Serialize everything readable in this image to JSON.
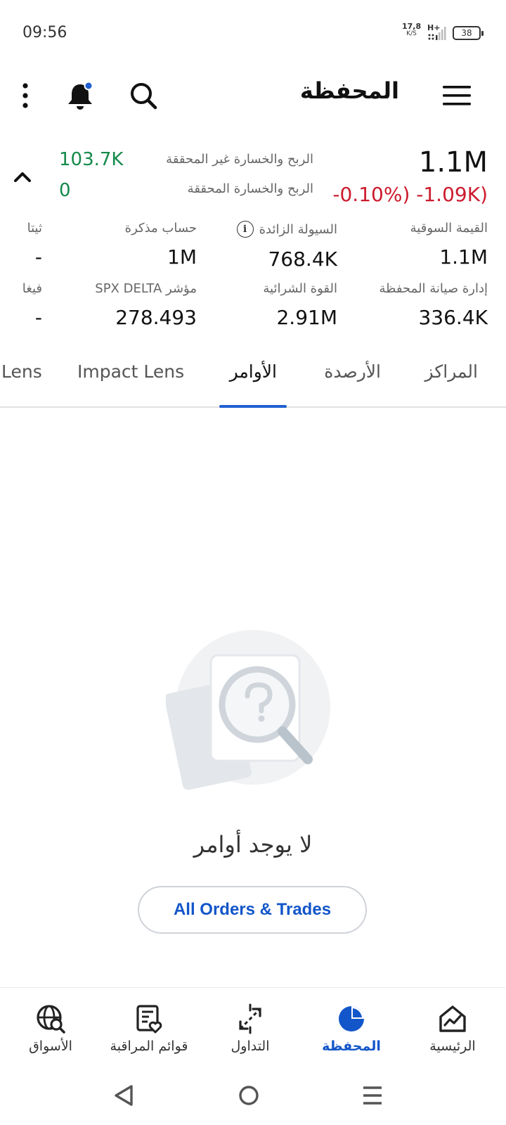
{
  "status": {
    "time": "09:56",
    "net_speed": "17,8",
    "net_unit": "K/S",
    "network_type": "H+",
    "battery": "38"
  },
  "header": {
    "title": "المحفظة",
    "icons": [
      "menu-icon",
      "search-icon",
      "bell-icon",
      "more-vertical-icon"
    ]
  },
  "summary": {
    "market_value": "1.1M",
    "change": "-0.10%) -1.09K)",
    "unrealized_pnl_label": "الربح والخسارة غير المحققة",
    "unrealized_pnl_value": "103.7K",
    "realized_pnl_label": "الربح والخسارة المحققة",
    "realized_pnl_value": "0"
  },
  "metrics": {
    "row1": [
      {
        "label": "القيمة السوقية",
        "value": "1.1M"
      },
      {
        "label": "السيولة الزائدة",
        "value": "768.4K",
        "has_info": true
      },
      {
        "label": "حساب مذكرة",
        "value": "1M"
      },
      {
        "label": "ثيتا",
        "value": "-"
      }
    ],
    "row2": [
      {
        "label": "إدارة صيانة المحفظة",
        "value": "336.4K"
      },
      {
        "label": "القوة الشرائية",
        "value": "2.91M"
      },
      {
        "label": "مؤشر SPX DELTA",
        "value": "278.493"
      },
      {
        "label": "فيغا",
        "value": "-"
      }
    ]
  },
  "tabs": [
    {
      "label": "المراكز",
      "active": false
    },
    {
      "label": "الأرصدة",
      "active": false
    },
    {
      "label": "الأوامر",
      "active": true
    },
    {
      "label": "Impact Lens",
      "active": false
    },
    {
      "label": "Lens",
      "active": false
    }
  ],
  "empty_state": {
    "message": "لا يوجد أوامر",
    "button_label": "All Orders & Trades"
  },
  "bottom_nav": [
    {
      "label": "الرئيسية",
      "icon": "home-chart-icon",
      "active": false
    },
    {
      "label": "المحفظة",
      "icon": "pie-chart-icon",
      "active": true
    },
    {
      "label": "التداول",
      "icon": "trade-arrows-icon",
      "active": false
    },
    {
      "label": "قوائم المراقبة",
      "icon": "watchlist-icon",
      "active": false
    },
    {
      "label": "الأسواق",
      "icon": "globe-search-icon",
      "active": false
    }
  ],
  "colors": {
    "accent": "#1356c9",
    "positive": "#148a4a",
    "negative": "#cc1b2e",
    "tab_indicator": "#1f5fd1"
  }
}
